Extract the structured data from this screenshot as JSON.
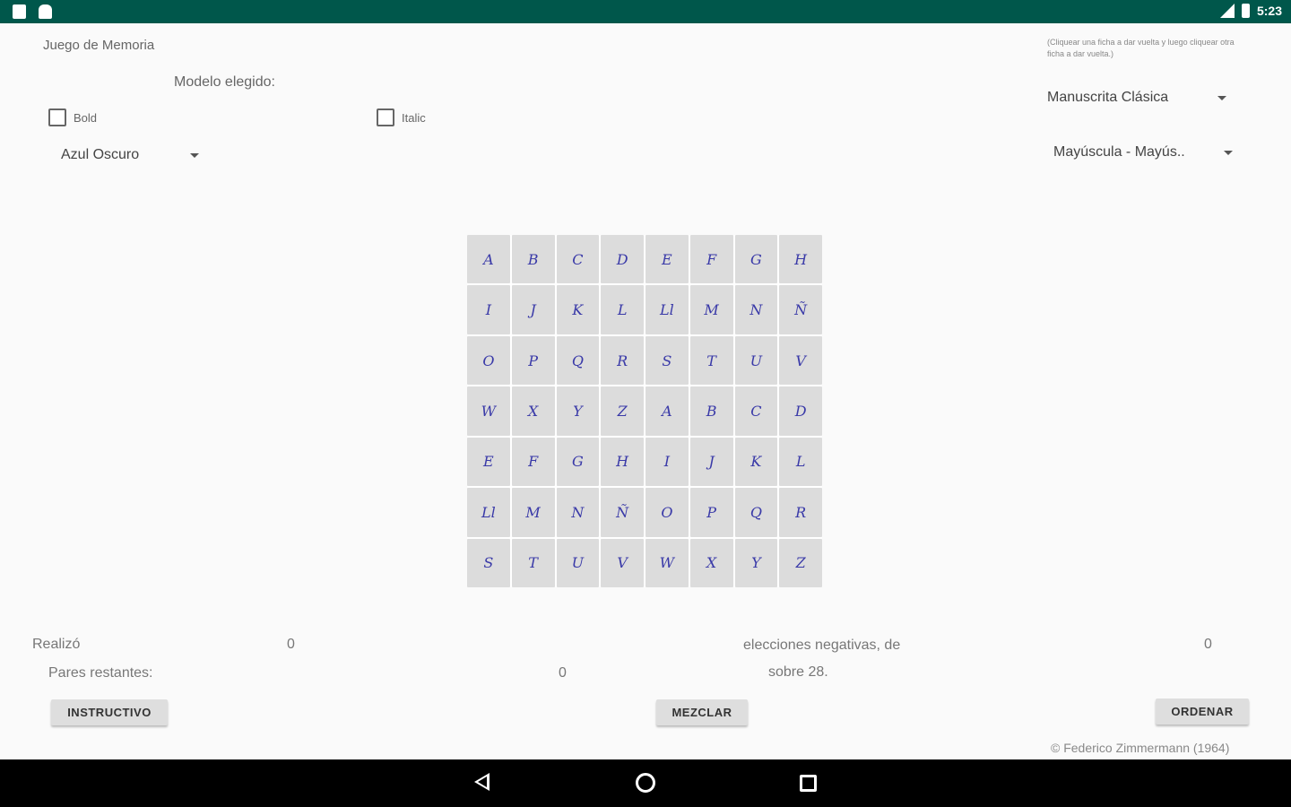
{
  "status_bar": {
    "time": "5:23",
    "left_icons": [
      "sd-card-icon",
      "android-icon"
    ],
    "right_icons": [
      "signal-icon",
      "battery-icon"
    ]
  },
  "header": {
    "app_title": "Juego de Memoria",
    "hint": "(Cliquear una ficha a dar vuelta y luego cliquear otra ficha a dar vuelta.)",
    "model_label": "Modelo elegido:"
  },
  "options": {
    "bold_label": "Bold",
    "italic_label": "Italic",
    "color_selected": "Azul Oscuro",
    "font_selected": "Manuscrita Clásica",
    "case_selected": "Mayúscula - Mayús.."
  },
  "board": {
    "rows": [
      [
        "A",
        "B",
        "C",
        "D",
        "E",
        "F",
        "G",
        "H"
      ],
      [
        "I",
        "J",
        "K",
        "L",
        "Ll",
        "M",
        "N",
        "Ñ"
      ],
      [
        "O",
        "P",
        "Q",
        "R",
        "S",
        "T",
        "U",
        "V"
      ],
      [
        "W",
        "X",
        "Y",
        "Z",
        "A",
        "B",
        "C",
        "D"
      ],
      [
        "E",
        "F",
        "G",
        "H",
        "I",
        "J",
        "K",
        "L"
      ],
      [
        "Ll",
        "M",
        "N",
        "Ñ",
        "O",
        "P",
        "Q",
        "R"
      ],
      [
        "S",
        "T",
        "U",
        "V",
        "W",
        "X",
        "Y",
        "Z"
      ]
    ]
  },
  "stats": {
    "realizo_label": "Realizó",
    "realizo_value": "0",
    "negativas_label": "elecciones negativas, de",
    "negativas_value": "0",
    "pares_label": "Pares restantes:",
    "pares_value": "0",
    "sobre_label": "sobre 28."
  },
  "buttons": {
    "instructivo": "INSTRUCTIVO",
    "mezclar": "MEZCLAR",
    "ordenar": "ORDENAR"
  },
  "footer": {
    "copyright": "© Federico Zimmermann (1964)"
  },
  "colors": {
    "status_bar": "#00574b",
    "tile_bg": "#dcdcdc",
    "tile_text": "#3a3aa8",
    "nav_bar": "#000000"
  }
}
